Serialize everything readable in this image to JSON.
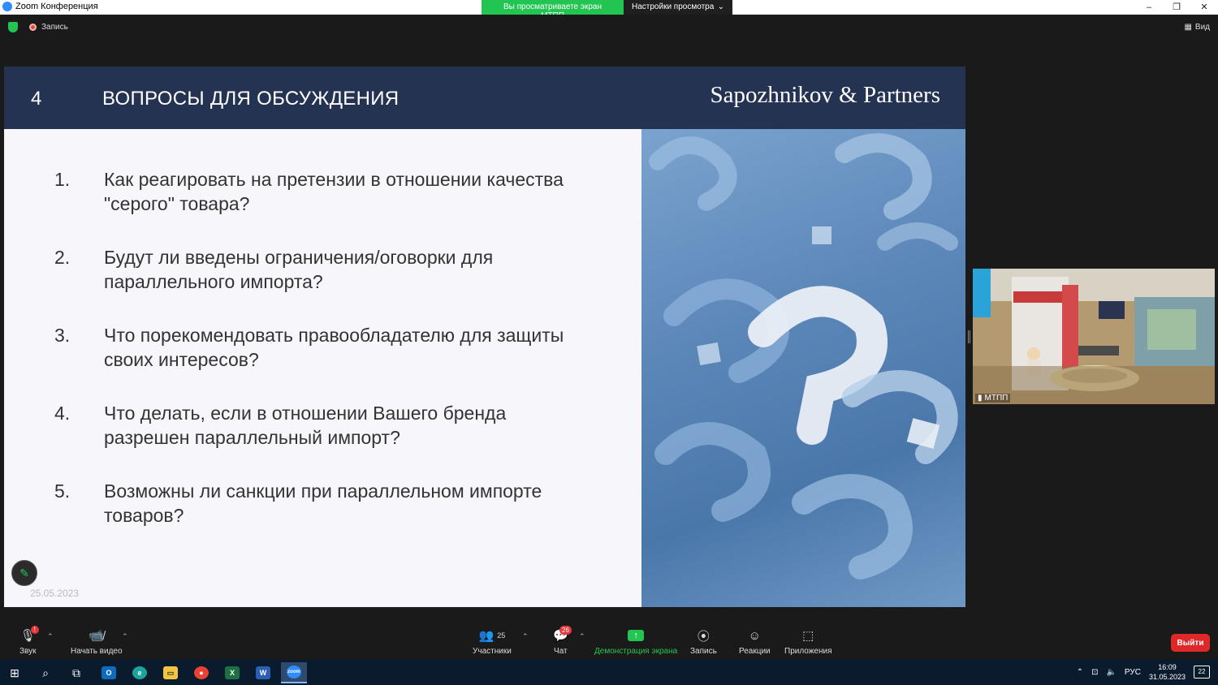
{
  "window": {
    "title": "Zoom Конференция",
    "share_banner": "Вы просматриваете экран МТПП",
    "view_settings": "Настройки просмотра",
    "controls": [
      "–",
      "❐",
      "✕"
    ]
  },
  "zoom_top": {
    "recording_label": "Запись",
    "view_label": "Вид"
  },
  "slide": {
    "number": "4",
    "title": "ВОПРОСЫ ДЛЯ ОБСУЖДЕНИЯ",
    "brand": "Sapozhnikov & Partners",
    "questions": [
      {
        "n": "1.",
        "line1": "Как реагировать на претензии в отношении качества",
        "line2": "\"серого\" товара?"
      },
      {
        "n": "2.",
        "line1": "Будут ли введены ограничения/оговорки для",
        "line2": "параллельного импорта?"
      },
      {
        "n": "3.",
        "line1": "Что порекомендовать правообладателю для защиты",
        "line2": "своих интересов?"
      },
      {
        "n": "4.",
        "line1": "Что делать, если в отношении Вашего бренда",
        "line2": "разрешен параллельный импорт?"
      },
      {
        "n": "5.",
        "line1": "Возможны ли санкции при параллельном импорте",
        "line2": "товаров?"
      }
    ],
    "date": "25.05.2023"
  },
  "video": {
    "participant_name": "МТПП"
  },
  "toolbar": {
    "audio": "Звук",
    "video": "Начать видео",
    "participants": "Участники",
    "participants_count": "25",
    "chat": "Чат",
    "chat_badge": "26",
    "share": "Демонстрация экрана",
    "record": "Запись",
    "reactions": "Реакции",
    "apps": "Приложения",
    "leave": "Выйти"
  },
  "taskbar": {
    "time": "16:09",
    "date": "31.05.2023",
    "lang": "РУС",
    "notifications": "22"
  },
  "colors": {
    "header_bg": "#243352",
    "accent_green": "#23c552",
    "leave_red": "#e02828"
  }
}
